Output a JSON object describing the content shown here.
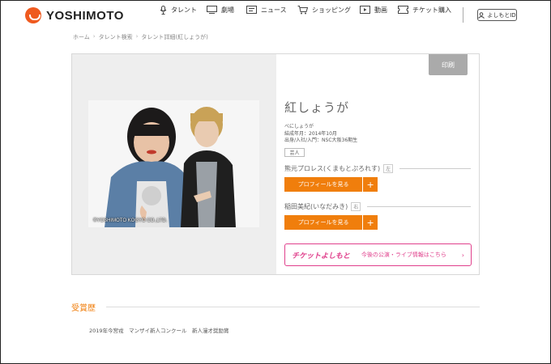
{
  "header": {
    "logo_text": "YOSHIMOTO",
    "nav": [
      {
        "label": "タレント",
        "icon": "microphone-icon"
      },
      {
        "label": "劇場",
        "icon": "theater-icon"
      },
      {
        "label": "ニュース",
        "icon": "news-icon"
      },
      {
        "label": "ショッピング",
        "icon": "cart-icon"
      },
      {
        "label": "動画",
        "icon": "video-icon"
      },
      {
        "label": "チケット購入",
        "icon": "ticket-icon"
      }
    ],
    "login_label": "よしもとID"
  },
  "breadcrumb": [
    "ホーム",
    "タレント検索",
    "タレント詳細(紅しょうが)"
  ],
  "talent": {
    "print_label": "印刷",
    "photo_caption": "©YOSHIMOTO KOGYO CO.,LTD.",
    "name": "紅しょうが",
    "reading": "べにしょうが",
    "formed": "結成年月：2014年10月",
    "origin": "出身/入社/入門：NSC大阪36期生",
    "category": "芸人",
    "members": [
      {
        "name": "熊元プロレス(くまもとぷろれす)",
        "role": "左",
        "button": "プロフィールを見る",
        "plus": "+"
      },
      {
        "name": "稲田美紀(いなだみき)",
        "role": "右",
        "button": "プロフィールを見る",
        "plus": "+"
      }
    ],
    "ticket": {
      "logo": "チケットよしもと",
      "text": "今後の公演・ライブ情報はこちら",
      "arrow": "›"
    }
  },
  "awards": {
    "title": "受賞歴",
    "items": [
      "2019年今宮戎　マンザイ新人コンクール　新人漫才奨励賞"
    ]
  },
  "colors": {
    "brand": "#ef5a1f",
    "accent": "#f07e0c",
    "ticket": "#e0408c"
  }
}
